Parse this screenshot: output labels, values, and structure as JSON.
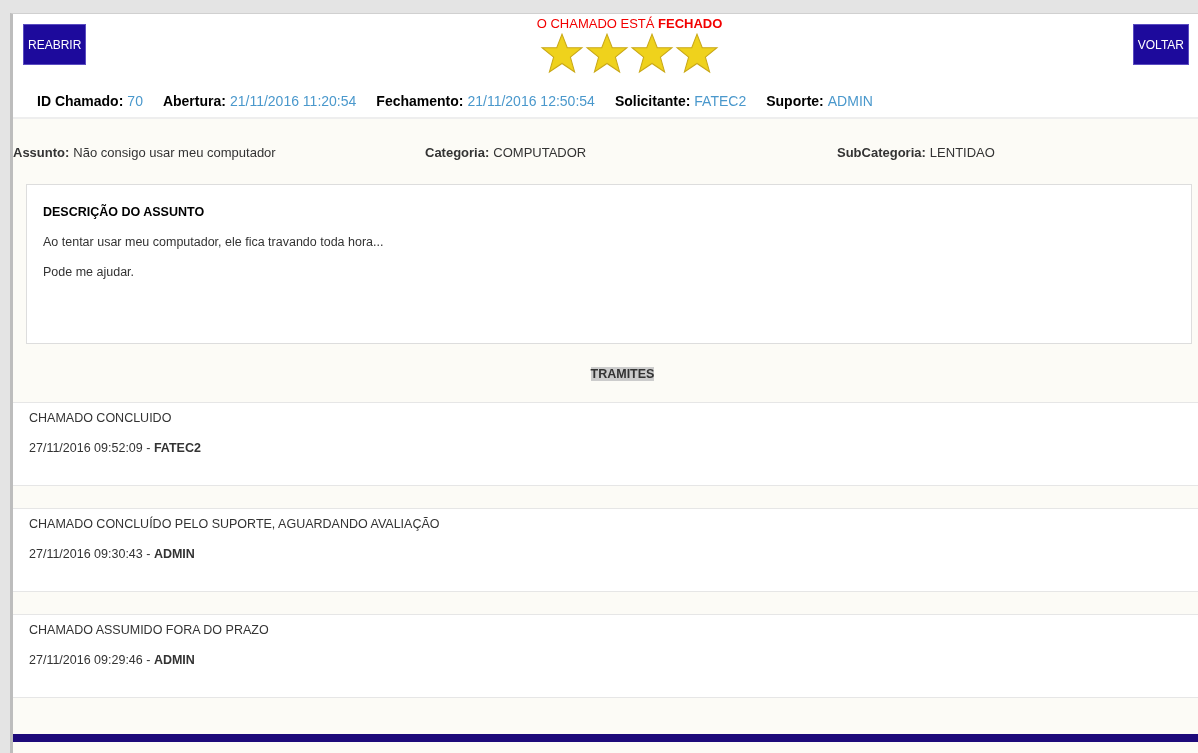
{
  "header": {
    "reopen_button": "REABRIR",
    "status": "O CHAMADO ESTÁ **FECHADO**",
    "rating": {
      "stars": 4
    },
    "back_button": "VOLTAR"
  },
  "info": [
    {
      "label": "ID Chamado:",
      "value": "70"
    },
    {
      "label": "Abertura:",
      "value": "21/11/2016 11:20:54"
    },
    {
      "label": "Fechamento:",
      "value": "21/11/2016 12:50:54"
    },
    {
      "label": "Solicitante:",
      "value": "FATEC2"
    },
    {
      "label": "Suporte:",
      "value": "ADMIN"
    }
  ],
  "subject": [
    {
      "label": "Assunto:",
      "value": "Não consigo usar meu computador"
    },
    {
      "label": "Categoria:",
      "value": "COMPUTADOR"
    },
    {
      "label": "SubCategoria:",
      "value": "LENTIDAO"
    }
  ],
  "description": {
    "title": "DESCRIÇÃO DO ASSUNTO",
    "paragraphs": [
      "Ao tentar usar meu computador, ele fica travando toda hora...",
      "Pode me ajudar."
    ]
  },
  "tramites": {
    "title": "TRAMITES",
    "entries": [
      {
        "text": "CHAMADO CONCLUIDO",
        "meta": "27/11/2016 09:52:09 - **FATEC2**"
      },
      {
        "text": "CHAMADO CONCLUÍDO PELO SUPORTE, AGUARDANDO AVALIAÇÃO",
        "meta": "27/11/2016 09:30:43 - **ADMIN**"
      },
      {
        "text": "CHAMADO ASSUMIDO FORA DO PRAZO",
        "meta": "27/11/2016 09:29:46 - **ADMIN**"
      }
    ]
  }
}
